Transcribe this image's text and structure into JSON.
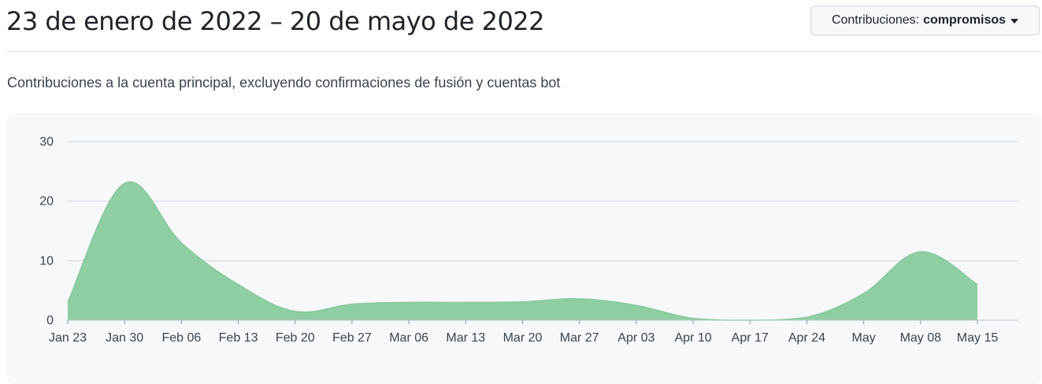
{
  "header": {
    "title": "23 de enero de 2022 – 20 de mayo de 2022",
    "dropdown": {
      "label": "Contribuciones:",
      "selected": "compromisos"
    }
  },
  "subtitle": "Contribuciones a la cuenta principal, excluyendo confirmaciones de fusión y cuentas bot",
  "colors": {
    "area_fill": "#8fcea2",
    "area_stroke": "#86c99b",
    "gridline": "#d0d7de",
    "panel_background": "#f6f8fa"
  },
  "chart_data": {
    "type": "area",
    "title": "",
    "xlabel": "",
    "ylabel": "",
    "ylim": [
      0,
      30
    ],
    "y_ticks": [
      "0",
      "10",
      "20",
      "30"
    ],
    "x_ticks": [
      "Jan 23",
      "Jan 30",
      "Feb 06",
      "Feb 13",
      "Feb 20",
      "Feb 27",
      "Mar 06",
      "Mar 13",
      "Mar 20",
      "Mar 27",
      "Apr 03",
      "Apr 10",
      "Apr 17",
      "Apr 24",
      "May",
      "May 08",
      "May 15"
    ],
    "grid": true,
    "legend": "none",
    "series": [
      {
        "x": [
          "2022-01-23",
          "2022-01-30",
          "2022-02-06",
          "2022-02-13",
          "2022-02-20",
          "2022-02-27",
          "2022-03-06",
          "2022-03-13",
          "2022-03-20",
          "2022-03-27",
          "2022-04-03",
          "2022-04-10",
          "2022-04-17",
          "2022-04-24",
          "2022-05-01",
          "2022-05-08",
          "2022-05-15"
        ],
        "values": [
          3,
          23,
          13,
          6,
          1.5,
          2.7,
          3,
          3,
          3.1,
          3.6,
          2.5,
          0.3,
          0,
          0.5,
          4.5,
          11.5,
          6
        ]
      }
    ]
  }
}
